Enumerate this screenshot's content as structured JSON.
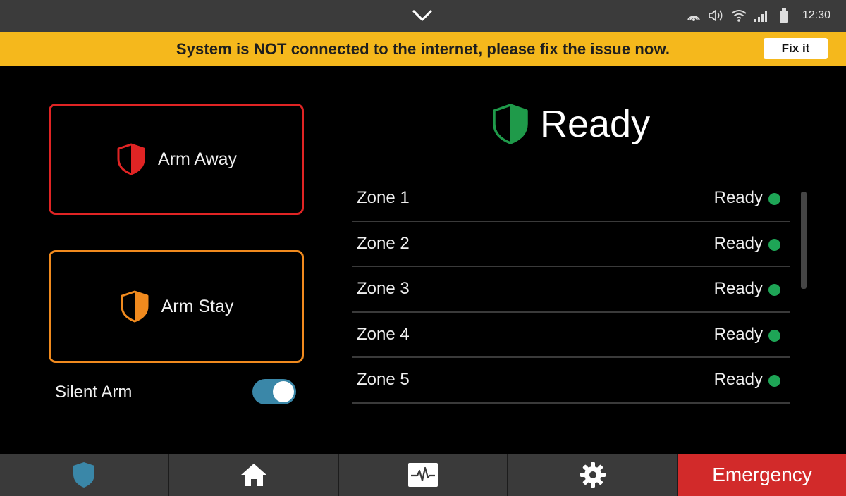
{
  "status_bar": {
    "time": "12:30",
    "icons": [
      "collapse-chevron-icon",
      "nfc-icon",
      "volume-icon",
      "wifi-icon",
      "signal-icon",
      "battery-icon"
    ]
  },
  "banner": {
    "message": "System is NOT connected to the internet, please fix the issue now.",
    "action_label": "Fix it",
    "color": "#f5b81c"
  },
  "arm_away": {
    "label": "Arm Away",
    "color": "#e02424",
    "icon": "shield-half-red-icon"
  },
  "arm_stay": {
    "label": "Arm Stay",
    "color": "#f08a1e",
    "icon": "shield-half-orange-icon"
  },
  "silent_arm": {
    "label": "Silent Arm",
    "enabled": true
  },
  "system_status": {
    "label": "Ready",
    "color": "#1f9a4a",
    "icon": "shield-half-green-icon"
  },
  "zones": [
    {
      "name": "Zone 1",
      "status": "Ready",
      "status_color": "#1ea556"
    },
    {
      "name": "Zone 2",
      "status": "Ready",
      "status_color": "#1ea556"
    },
    {
      "name": "Zone 3",
      "status": "Ready",
      "status_color": "#1ea556"
    },
    {
      "name": "Zone 4",
      "status": "Ready",
      "status_color": "#1ea556"
    },
    {
      "name": "Zone 5",
      "status": "Ready",
      "status_color": "#1ea556"
    }
  ],
  "bottom_nav": {
    "items": [
      "security-shield-icon",
      "home-icon",
      "activity-monitor-icon",
      "settings-gear-icon"
    ],
    "emergency_label": "Emergency",
    "emergency_color": "#d22a2a",
    "active_color": "#3a87a8"
  }
}
